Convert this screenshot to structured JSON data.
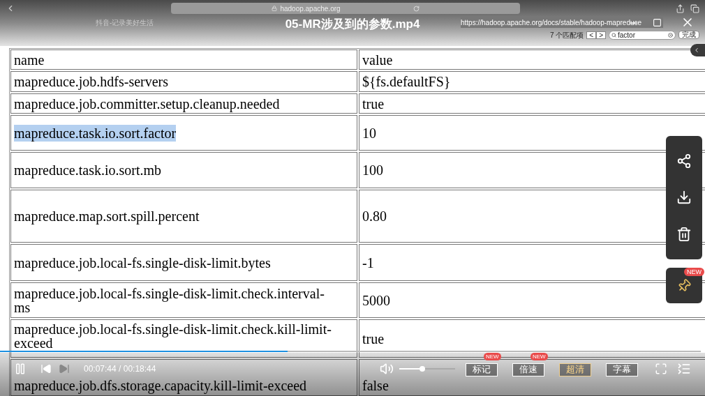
{
  "video": {
    "title": "05-MR涉及到的参数.mp4",
    "time": "00:07:44 / 00:18:44",
    "progress": {
      "level": 0.41
    },
    "volume": {
      "level": 0.41
    },
    "pin_badge": "NEW"
  },
  "browser": {
    "address": "hadoop.apache.org",
    "tabs": [
      {
        "label": "抖音-记录美好生活",
        "selected": false
      },
      {
        "label": "https://hadoop.apache.org/docs/stable/hadoop-mapreduce",
        "selected": true
      }
    ],
    "find": {
      "matches": "7 个匹配项",
      "prev": "<",
      "next": ">",
      "query": "factor",
      "done": "完成"
    }
  },
  "table": {
    "columns": [
      "name",
      "value"
    ],
    "rows": [
      {
        "name": "mapreduce.job.hdfs-servers",
        "value": "${fs.defaultFS}",
        "selected": false
      },
      {
        "name": "mapreduce.job.committer.setup.cleanup.needed",
        "value": "true",
        "selected": false
      },
      {
        "name": "mapreduce.task.io.sort.factor",
        "value": "10",
        "selected": true
      },
      {
        "name": "mapreduce.task.io.sort.mb",
        "value": "100",
        "selected": false
      },
      {
        "name": "mapreduce.map.sort.spill.percent",
        "value": "0.80",
        "selected": false
      },
      {
        "name": "mapreduce.job.local-fs.single-disk-limit.bytes",
        "value": "-1",
        "selected": false
      },
      {
        "name": "mapreduce.job.local-fs.single-disk-limit.check.interval-ms",
        "value": "5000",
        "selected": false
      },
      {
        "name": "mapreduce.job.local-fs.single-disk-limit.check.kill-limit-exceed",
        "value": "true",
        "selected": false
      },
      {
        "name": "mapreduce.job.dfs.storage.capacity.kill-limit-exceed",
        "value": "false",
        "selected": false
      }
    ]
  },
  "side_actions": [
    {
      "kind": "share"
    },
    {
      "kind": "download"
    },
    {
      "kind": "delete"
    }
  ],
  "controls": [
    {
      "label": "标记",
      "badge": "NEW",
      "selected": false
    },
    {
      "label": "倍速",
      "badge": "NEW",
      "selected": false
    },
    {
      "label": "超清",
      "selected": true
    },
    {
      "label": "字幕",
      "selected": false
    }
  ]
}
